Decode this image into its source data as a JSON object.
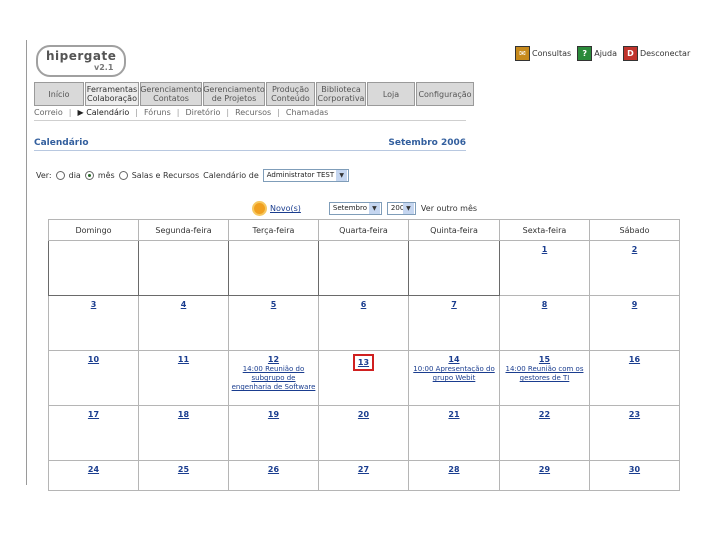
{
  "logo": {
    "name": "hipergate",
    "version": "v2.1"
  },
  "top_links": [
    {
      "label": "Consultas",
      "icon": "consultas-icon"
    },
    {
      "label": "Ajuda",
      "icon": "help-icon"
    },
    {
      "label": "Desconectar",
      "icon": "disconnect-icon"
    }
  ],
  "main_menu": [
    {
      "line1": "Início",
      "line2": ""
    },
    {
      "line1": "Ferramentas",
      "line2": "Colaboração"
    },
    {
      "line1": "Gerenciamento",
      "line2": "Contatos"
    },
    {
      "line1": "Gerenciamento",
      "line2": "de Projetos"
    },
    {
      "line1": "Produção",
      "line2": "Conteúdo"
    },
    {
      "line1": "Biblioteca",
      "line2": "Corporativa"
    },
    {
      "line1": "Loja",
      "line2": ""
    },
    {
      "line1": "Configuração",
      "line2": ""
    }
  ],
  "sub_menu": [
    "Correio",
    "Calendário",
    "Fóruns",
    "Diretório",
    "Recursos",
    "Chamadas"
  ],
  "page": {
    "title": "Calendário",
    "month_label": "Setembro 2006"
  },
  "view": {
    "label": "Ver:",
    "options": [
      "dia",
      "mês",
      "Salas e Recursos"
    ],
    "calendar_label": "Calendário de",
    "calendar_value": "Administrator TEST"
  },
  "nav": {
    "new_label": "Novo(s)",
    "month_value": "Setembro",
    "year_value": "2006",
    "view_other": "Ver outro mês"
  },
  "weekdays": [
    "Domingo",
    "Segunda-feira",
    "Terça-feira",
    "Quarta-feira",
    "Quinta-feira",
    "Sexta-feira",
    "Sábado"
  ],
  "weeks": [
    [
      null,
      null,
      null,
      null,
      null,
      {
        "day": "1"
      },
      {
        "day": "2"
      }
    ],
    [
      {
        "day": "3"
      },
      {
        "day": "4"
      },
      {
        "day": "5"
      },
      {
        "day": "6"
      },
      {
        "day": "7"
      },
      {
        "day": "8"
      },
      {
        "day": "9"
      }
    ],
    [
      {
        "day": "10"
      },
      {
        "day": "11"
      },
      {
        "day": "12",
        "events": [
          "14:00 Reunião do subgrupo de engenharia de Software"
        ]
      },
      {
        "day": "13",
        "today": true
      },
      {
        "day": "14",
        "events": [
          "10:00 Apresentação do grupo Webit"
        ]
      },
      {
        "day": "15",
        "events": [
          "14:00 Reunião com os gestores de TI"
        ]
      },
      {
        "day": "16"
      }
    ],
    [
      {
        "day": "17"
      },
      {
        "day": "18"
      },
      {
        "day": "19"
      },
      {
        "day": "20"
      },
      {
        "day": "21"
      },
      {
        "day": "22"
      },
      {
        "day": "23"
      }
    ],
    [
      {
        "day": "24"
      },
      {
        "day": "25"
      },
      {
        "day": "26"
      },
      {
        "day": "27"
      },
      {
        "day": "28"
      },
      {
        "day": "29"
      },
      {
        "day": "30"
      }
    ]
  ]
}
